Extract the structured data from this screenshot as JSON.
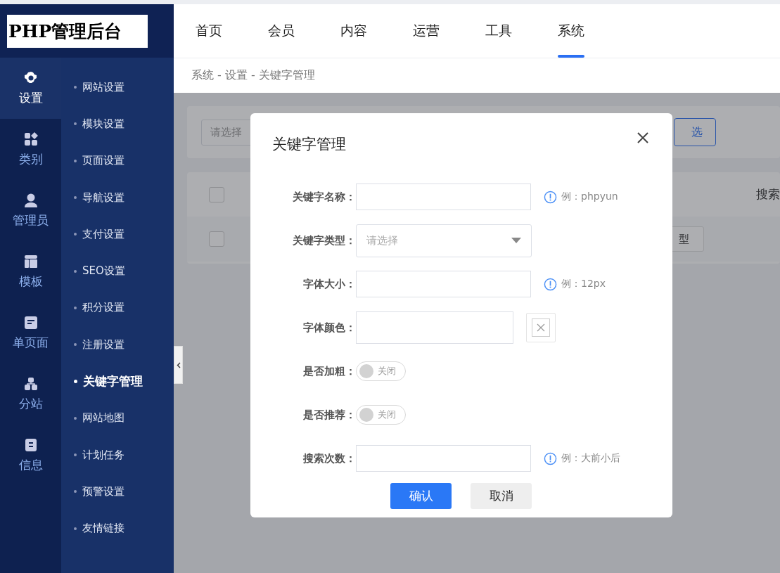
{
  "logo": "PHP管理后台",
  "top_nav": [
    {
      "label": "首页",
      "selected": false
    },
    {
      "label": "会员",
      "selected": false
    },
    {
      "label": "内容",
      "selected": false
    },
    {
      "label": "运营",
      "selected": false
    },
    {
      "label": "工具",
      "selected": false
    },
    {
      "label": "系统",
      "selected": true
    }
  ],
  "breadcrumb": "系统 - 设置 - 关键字管理",
  "sidebar": {
    "items": [
      {
        "label": "设置",
        "selected": true
      },
      {
        "label": "类别",
        "selected": false
      },
      {
        "label": "管理员",
        "selected": false
      },
      {
        "label": "模板",
        "selected": false
      },
      {
        "label": "单页面",
        "selected": false
      },
      {
        "label": "分站",
        "selected": false
      },
      {
        "label": "信息",
        "selected": false
      }
    ],
    "submenu": [
      {
        "label": "网站设置",
        "selected": false
      },
      {
        "label": "模块设置",
        "selected": false
      },
      {
        "label": "页面设置",
        "selected": false
      },
      {
        "label": "导航设置",
        "selected": false
      },
      {
        "label": "支付设置",
        "selected": false
      },
      {
        "label": "SEO设置",
        "selected": false
      },
      {
        "label": "积分设置",
        "selected": false
      },
      {
        "label": "注册设置",
        "selected": false
      },
      {
        "label": "关键字管理",
        "selected": true
      },
      {
        "label": "网站地图",
        "selected": false
      },
      {
        "label": "计划任务",
        "selected": false
      },
      {
        "label": "预警设置",
        "selected": false
      },
      {
        "label": "友情链接",
        "selected": false
      }
    ]
  },
  "background": {
    "filter_placeholder": "请选择",
    "filter_button": "选",
    "table_header": {
      "checked": false,
      "text": "搜索"
    },
    "rows": [
      {
        "checked": false,
        "button": "型"
      }
    ]
  },
  "dialog": {
    "title": "关键字管理",
    "fields": [
      {
        "kind": "text",
        "label": "关键字名称：",
        "hint": "例：phpyun"
      },
      {
        "kind": "select",
        "label": "关键字类型：",
        "placeholder": "请选择"
      },
      {
        "kind": "text",
        "label": "字体大小：",
        "hint": "例：12px"
      },
      {
        "kind": "color",
        "label": "字体颜色："
      },
      {
        "kind": "switch",
        "label": "是否加粗：",
        "on": false,
        "state_text": "关闭"
      },
      {
        "kind": "switch",
        "label": "是否推荐：",
        "on": false,
        "state_text": "关闭"
      },
      {
        "kind": "text",
        "label": "搜索次数：",
        "hint": "例：大前小后"
      }
    ],
    "buttons": [
      {
        "label": "确认",
        "kind": "primary"
      },
      {
        "label": "取消",
        "kind": "secondary"
      }
    ]
  }
}
